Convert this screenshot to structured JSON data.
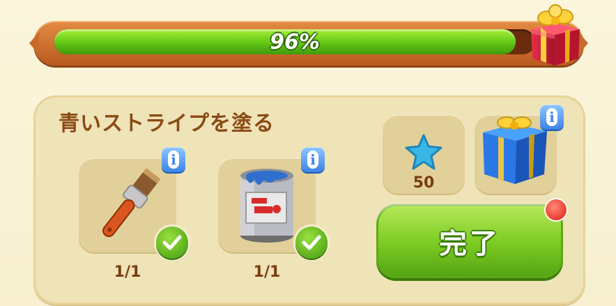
{
  "progress": {
    "percent_label": "96%",
    "fraction": 0.96
  },
  "task": {
    "title": "青いストライプを塗る"
  },
  "requirements": [
    {
      "name": "paintbrush",
      "count": "1/1",
      "completed": true
    },
    {
      "name": "paint-can",
      "count": "1/1",
      "completed": true
    }
  ],
  "rewards": {
    "stars": "50"
  },
  "info_label": "i",
  "done_button": {
    "label": "完了"
  },
  "colors": {
    "accent_green": "#6ccf1a",
    "frame_orange": "#c96a2a",
    "title_brown": "#8a4a14",
    "info_blue": "#3b83e6"
  }
}
